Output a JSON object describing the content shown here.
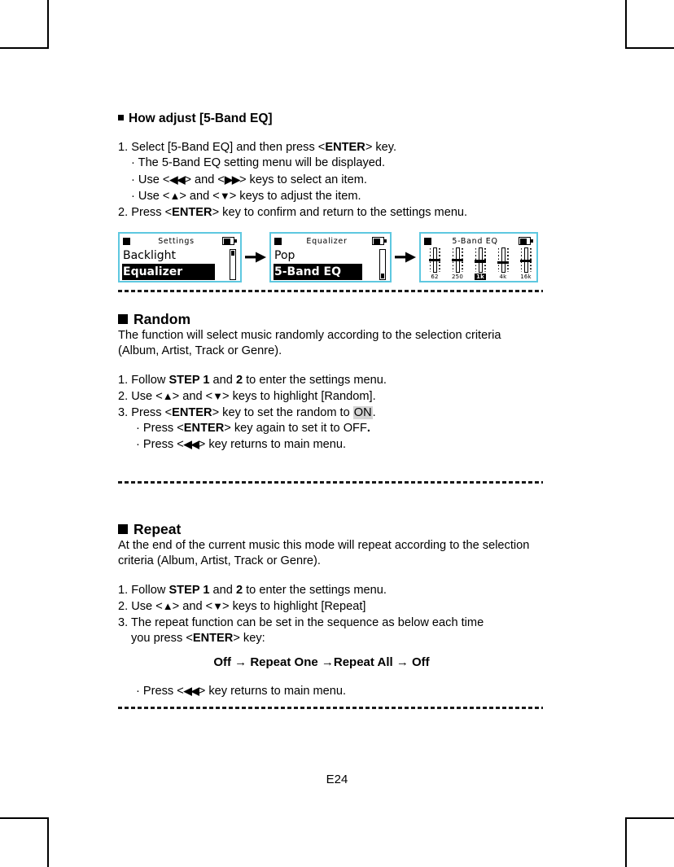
{
  "page": {
    "footer_label": "E24"
  },
  "sections": {
    "eq": {
      "heading": "How adjust [5-Band EQ]",
      "steps": [
        "1. Select [5-Band EQ] and then press <",
        "ENTER",
        "> key."
      ],
      "step1_prefix": "1. Select [5-Band EQ] and then press <",
      "step1_bold": "ENTER",
      "step1_suffix": "> key.",
      "bullet1": "· The 5-Band EQ setting menu will be displayed.",
      "bullet2_prefix": "· Use <",
      "bullet2_left": "◀◀",
      "bullet2_mid": "> and <",
      "bullet2_right": "▶▶",
      "bullet2_suffix": "> keys to select an item.",
      "bullet3_prefix": "· Use <",
      "bullet3_up": "▲",
      "bullet3_mid": "> and <",
      "bullet3_down": "▼",
      "bullet3_suffix": "> keys to adjust the item.",
      "step2_prefix": "2. Press <",
      "step2_bold": "ENTER",
      "step2_suffix": "> key to confirm and return to the settings menu."
    },
    "random": {
      "heading": "Random",
      "desc": "The function will select music randomly according to the selection criteria (Album, Artist, Track or Genre).",
      "step1_prefix": "1. Follow ",
      "step1_b1": "STEP 1",
      "step1_mid": " and ",
      "step1_b2": "2",
      "step1_suffix": " to enter the settings menu.",
      "step2_prefix": "2. Use <",
      "step2_up": "▲",
      "step2_mid": "> and <",
      "step2_down": "▼",
      "step2_suffix": "> keys to highlight [Random].",
      "step3_prefix": "3. Press <",
      "step3_bold": "ENTER",
      "step3_mid": "> key to set the random to ",
      "step3_hl": "ON",
      "step3_suffix": ".",
      "bullet1_prefix": "· Press <",
      "bullet1_bold": "ENTER",
      "bullet1_suffix": "> key again to set it to OFF",
      "bullet1_period": ".",
      "bullet2_prefix": "· Press <",
      "bullet2_left": "◀◀",
      "bullet2_suffix": "> key returns to main menu."
    },
    "repeat": {
      "heading": "Repeat",
      "desc": "At the end of the current music this mode will repeat according to the selection criteria (Album, Artist, Track or Genre).",
      "step1_prefix": "1. Follow ",
      "step1_b1": "STEP 1",
      "step1_mid": " and ",
      "step1_b2": "2",
      "step1_suffix": " to enter the settings menu.",
      "step2_prefix": "2. Use <",
      "step2_up": "▲",
      "step2_mid": "> and <",
      "step2_down": "▼",
      "step2_suffix": "> keys to highlight [Repeat]",
      "step3_line1_prefix": "3. The repeat function can be set in the sequence as below each time",
      "step3_line2_prefix": "you press <",
      "step3_line2_bold": "ENTER",
      "step3_line2_suffix": "> key:",
      "sequence": "Off → Repeat One →Repeat All → Off",
      "bullet1_prefix": "· Press <",
      "bullet1_left": "◀◀",
      "bullet1_suffix": "> key returns to main menu."
    }
  },
  "lcd_screens": [
    {
      "title": "Settings",
      "rows": [
        {
          "label": "Backlight",
          "selected": false
        },
        {
          "label": "Equalizer",
          "selected": true
        }
      ],
      "scroll_thumb": "top",
      "battery": "half"
    },
    {
      "title": "Equalizer",
      "rows": [
        {
          "label": "Pop",
          "selected": false
        },
        {
          "label": "5-Band EQ",
          "selected": true
        }
      ],
      "scroll_thumb": "bottom",
      "battery": "half"
    },
    {
      "title": "5-Band EQ",
      "battery": "half",
      "eq_bands": [
        {
          "label": "62",
          "selected": false,
          "position_pct": 50
        },
        {
          "label": "250",
          "selected": false,
          "position_pct": 50
        },
        {
          "label": "1k",
          "selected": true,
          "position_pct": 55
        },
        {
          "label": "4k",
          "selected": false,
          "position_pct": 60
        },
        {
          "label": "16k",
          "selected": false,
          "position_pct": 52
        }
      ]
    }
  ],
  "colors": {
    "lcd_border": "#5ec8e0",
    "highlight_gray": "#d4d4d4",
    "ink": "#000000"
  }
}
